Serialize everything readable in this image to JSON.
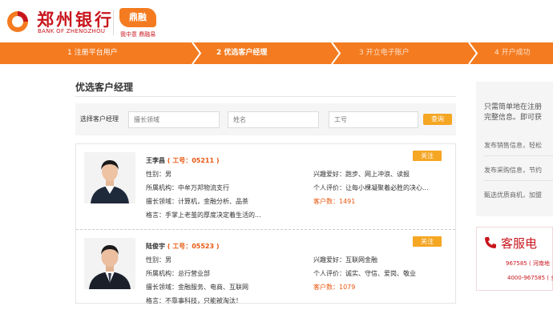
{
  "header": {
    "logo_cn": "郑州银行",
    "logo_en": "BANK OF ZHENGZHOU",
    "sub_brand": "鼎融",
    "sub_tagline": "我中意  鼎融易"
  },
  "steps": [
    {
      "label": "1 注册平台用户"
    },
    {
      "label": "2 优选客户经理"
    },
    {
      "label": "3 开立电子账户"
    },
    {
      "label": "4 开户成功"
    }
  ],
  "main": {
    "title": "优选客户经理",
    "filter": {
      "label": "选择客户经理",
      "specialty_placeholder": "擅长领域",
      "name_placeholder": "姓名",
      "job_placeholder": "工号",
      "query_label": "查询"
    },
    "managers": [
      {
        "name": "王李昌",
        "job_no": "( 工号：05211 )",
        "gender": "性别：男",
        "org": "所属机构：中牟万邦物流支行",
        "specialty": "擅长领域：计算机，金融分析、品茶",
        "motto": "格言：手掌上老茧的厚度决定着生活的...",
        "hobby": "兴趣爱好：跑步、网上冲浪、读报",
        "evaluation": "个人评价：让每小棵凝聚着必胜的决心...",
        "customers_label": "客户数：",
        "customers": "1491",
        "follow_label": "关注"
      },
      {
        "name": "陆俊宇",
        "job_no": "( 工号：05523 )",
        "gender": "性别：男",
        "org": "所属机构：总行营业部",
        "specialty": "擅长领域：金融服务、电商、互联网",
        "motto": "格言：不靠事科技，只能被淘汰！",
        "hobby": "兴趣爱好：互联网金融",
        "evaluation": "个人评价：诚实、守信、爱岗、敬业",
        "customers_label": "客户数：",
        "customers": "1079",
        "follow_label": "关注"
      }
    ]
  },
  "right_panel": {
    "intro_line1": "只需简单地在注册",
    "intro_line2": "完整信息。即可获",
    "item1": "发布销售信息，轻松",
    "item2": "发布采购信息，节约",
    "item3": "甄选优质商机，加盟"
  },
  "service": {
    "title": "客服电",
    "line1": "967585 ( 河南地",
    "line2": "4000-967585 ( 全"
  },
  "colors": {
    "brand_red": "#c8161d",
    "step_orange": "#f47b20",
    "button_orange": "#f5a623",
    "accent_text": "#e8560e"
  }
}
